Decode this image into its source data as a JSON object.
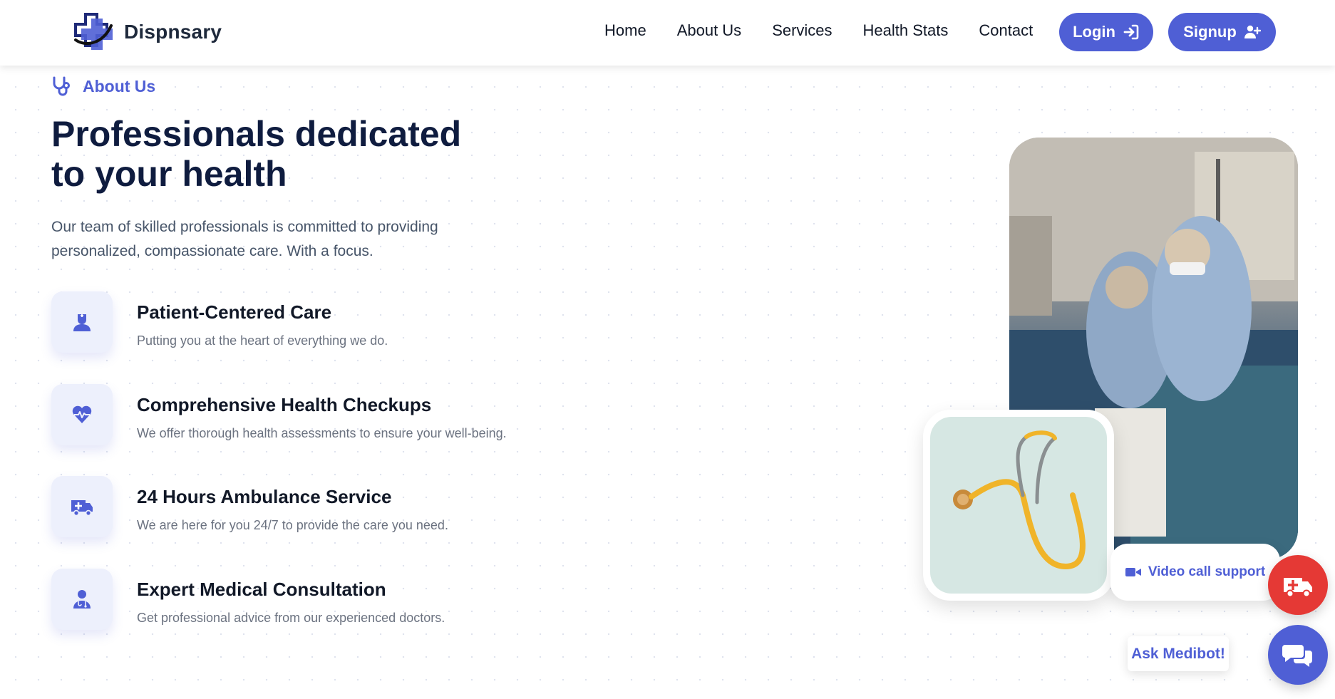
{
  "navbar": {
    "brand_name": "Dispnsary",
    "links": [
      "Home",
      "About Us",
      "Services",
      "Health Stats",
      "Contact"
    ],
    "login_label": "Login",
    "signup_label": "Signup"
  },
  "about": {
    "eyebrow": "About Us",
    "title_line1": "Professionals dedicated",
    "title_line2": "to your health",
    "lead_line1": "Our team of skilled professionals is committed to providing",
    "lead_line2": "personalized, compassionate care. With a focus.",
    "features": [
      {
        "title": "Patient-Centered Care",
        "desc": "Putting you at the heart of everything we do.",
        "icon": "doctor-icon"
      },
      {
        "title": "Comprehensive Health Checkups",
        "desc": "We offer thorough health assessments to ensure your well-being.",
        "icon": "heart-pulse-icon"
      },
      {
        "title": "24 Hours Ambulance Service",
        "desc": "We are here for you 24/7 to provide the care you need.",
        "icon": "ambulance-icon"
      },
      {
        "title": "Expert Medical Consultation",
        "desc": "Get professional advice from our experienced doctors.",
        "icon": "user-doctor-icon"
      }
    ]
  },
  "media": {
    "video_label": "Video call support"
  },
  "widgets": {
    "ask_bot_label": "Ask Medibot!"
  },
  "colors": {
    "accent": "#4f5fd5",
    "heading": "#0f1c3f",
    "emergency": "#e53935",
    "icon_bg": "#edf0fc"
  }
}
